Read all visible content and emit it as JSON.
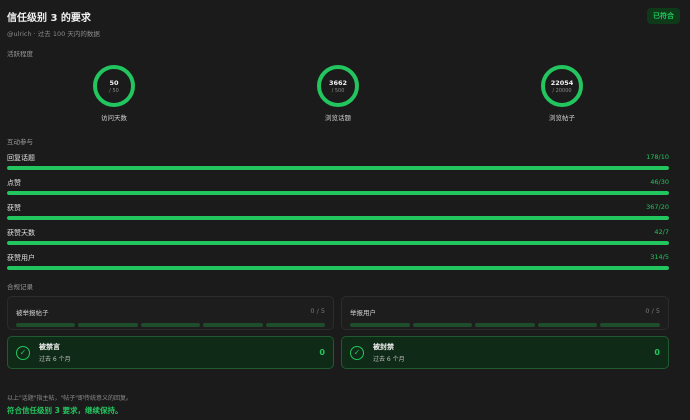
{
  "header": {
    "title": "信任级别 3 的要求",
    "badge": "已符合"
  },
  "subtitle": "@ulrich · 过去 100 天内的数据",
  "sections": {
    "activity": "活跃程度",
    "interaction": "互动参与",
    "compliance": "合规记录"
  },
  "circles": [
    {
      "value": "50",
      "req": "/ 50",
      "label": "访问天数"
    },
    {
      "value": "3662",
      "req": "/ 500",
      "label": "浏览话题"
    },
    {
      "value": "22054",
      "req": "/ 20000",
      "label": "浏览帖子"
    }
  ],
  "bars": [
    {
      "label": "回复话题",
      "value": "178/10",
      "progress": 1.0
    },
    {
      "label": "点赞",
      "value": "46/30",
      "progress": 1.0
    },
    {
      "label": "获赞",
      "value": "367/20",
      "progress": 1.0
    },
    {
      "label": "获赞天数",
      "value": "42/7",
      "progress": 1.0
    },
    {
      "label": "获赞用户",
      "value": "314/5",
      "progress": 1.0
    }
  ],
  "reports": [
    {
      "label": "被举报帖子",
      "count": "0 / 5"
    },
    {
      "label": "举报用户",
      "count": "0 / 5"
    }
  ],
  "penalties": [
    {
      "title": "被禁言",
      "sub": "过去 6 个月",
      "value": "0"
    },
    {
      "title": "被封禁",
      "sub": "过去 6 个月",
      "value": "0"
    }
  ],
  "note": "以上\"话题\"指主帖，\"帖子\"即传统意义的回复。",
  "summary": "符合信任级别 3 要求，继续保持。",
  "colors": {
    "accent": "#22c55e",
    "track": "#1e4d2b"
  },
  "icons": {
    "check": "check-icon"
  }
}
